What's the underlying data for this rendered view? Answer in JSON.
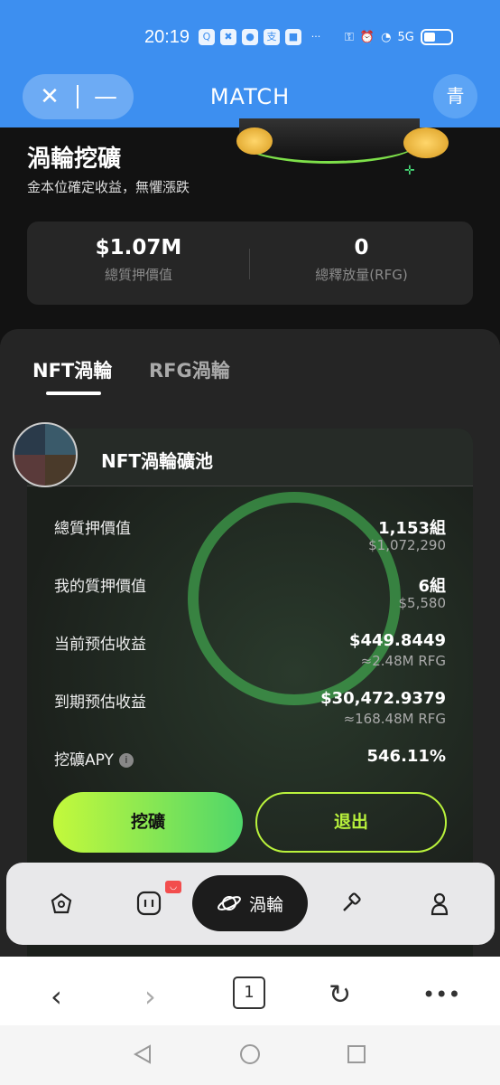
{
  "status_bar": {
    "time": "20:19",
    "network": "5G"
  },
  "header": {
    "title": "MATCH",
    "close_label": "✕",
    "minimize_label": "—",
    "avatar_text": "青"
  },
  "hero": {
    "title": "渦輪挖礦",
    "subtitle": "金本位確定收益，無懼漲跌",
    "stats": [
      {
        "value": "$1.07M",
        "label": "總質押價值"
      },
      {
        "value": "0",
        "label": "總釋放量(RFG)"
      }
    ]
  },
  "tabs": [
    {
      "label": "NFT渦輪"
    },
    {
      "label": "RFG渦輪"
    }
  ],
  "pool": {
    "title": "NFT渦輪礦池",
    "rows": [
      {
        "label": "總質押價值",
        "value": "1,153組",
        "sub": "$1,072,290"
      },
      {
        "label": "我的質押價值",
        "value": "6組",
        "sub": "$5,580"
      },
      {
        "label": "当前预估收益",
        "value": "$449.8449",
        "sub": "≈2.48M RFG"
      },
      {
        "label": "到期预估收益",
        "value": "$30,472.9379",
        "sub": "≈168.48M RFG"
      },
      {
        "label": "挖礦APY",
        "value": "546.11%",
        "sub": ""
      }
    ],
    "mine_button": "挖礦",
    "exit_button": "退出"
  },
  "bottom_nav": {
    "active_label": "渦輪"
  },
  "browser": {
    "tab_count": "1"
  }
}
